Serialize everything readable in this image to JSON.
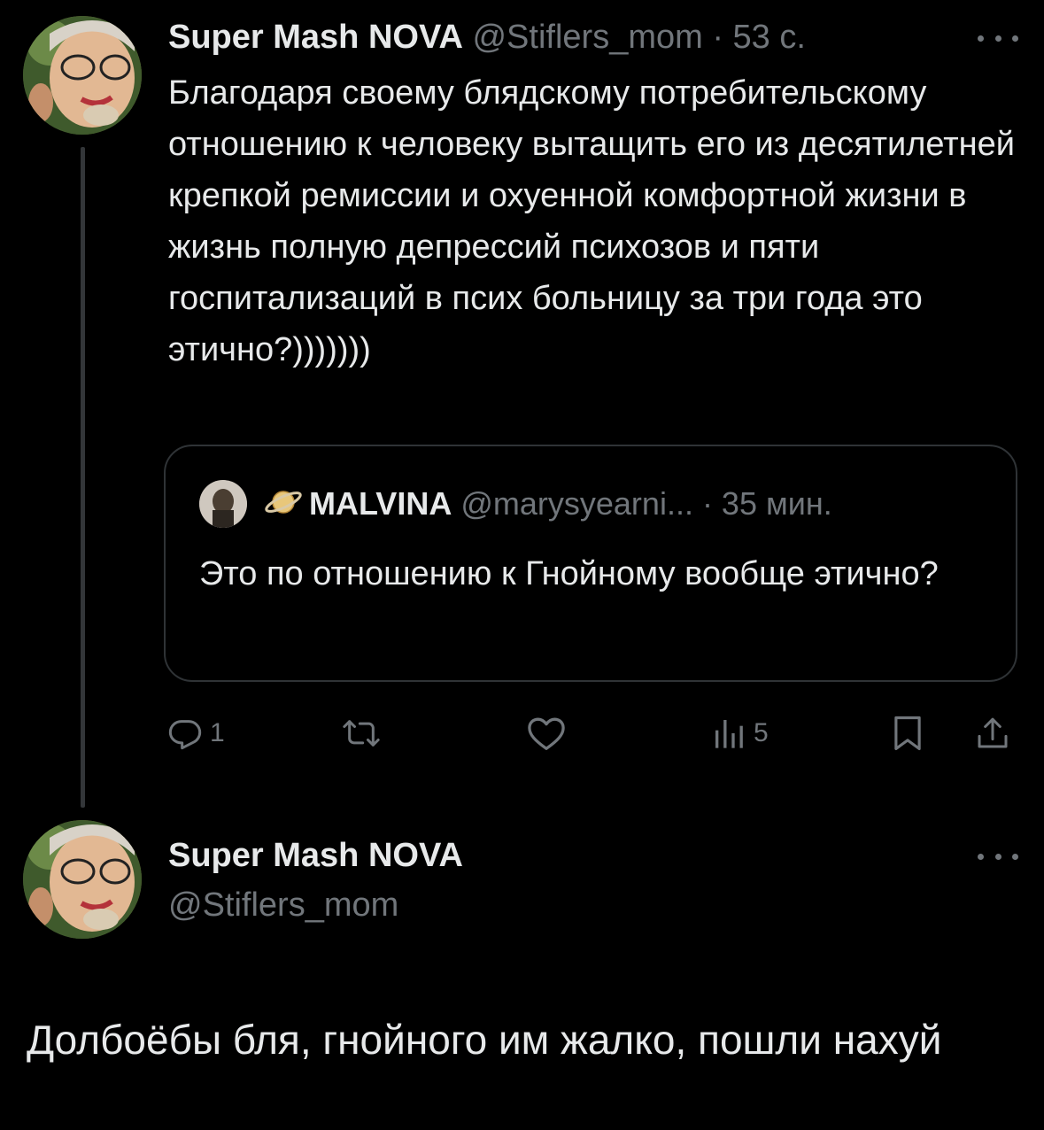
{
  "colors": {
    "background": "#000000",
    "text_primary": "#e7e9ea",
    "text_secondary": "#71767b",
    "border": "#2f3336",
    "thread_line": "#333639"
  },
  "tweet1": {
    "author": {
      "display_name": "Super Mash NOVA",
      "meta": "@Stiflers_mom · 53 с.",
      "avatar_icon": "user-avatar"
    },
    "more_icon": "more-horizontal-icon",
    "text": "Благодаря своему блядскому потребительскому отношению к человеку вытащить его из десятилетней крепкой ремиссии и охуенной комфортной жизни в жизнь полную депрессий психозов и пяти госпитализаций в псих больницу за три года это этично?)))))))",
    "quote": {
      "author_badge_icon": "saturn-icon",
      "display_name": "MALVINA",
      "meta": "@marysyearni... · 35 мин.",
      "text": "Это по отношению к Гнойному вообще этично?"
    },
    "actions": {
      "reply": {
        "icon": "reply-icon",
        "count": "1"
      },
      "retweet": {
        "icon": "retweet-icon",
        "count": ""
      },
      "like": {
        "icon": "heart-icon",
        "count": ""
      },
      "views": {
        "icon": "views-icon",
        "count": "5"
      },
      "bookmark": {
        "icon": "bookmark-icon"
      },
      "share": {
        "icon": "share-icon"
      }
    }
  },
  "tweet2": {
    "author": {
      "display_name": "Super Mash NOVA",
      "handle": "@Stiflers_mom",
      "avatar_icon": "user-avatar"
    },
    "more_icon": "more-horizontal-icon",
    "text": "Долбоёбы бля, гнойного им жалко, пошли нахуй"
  }
}
